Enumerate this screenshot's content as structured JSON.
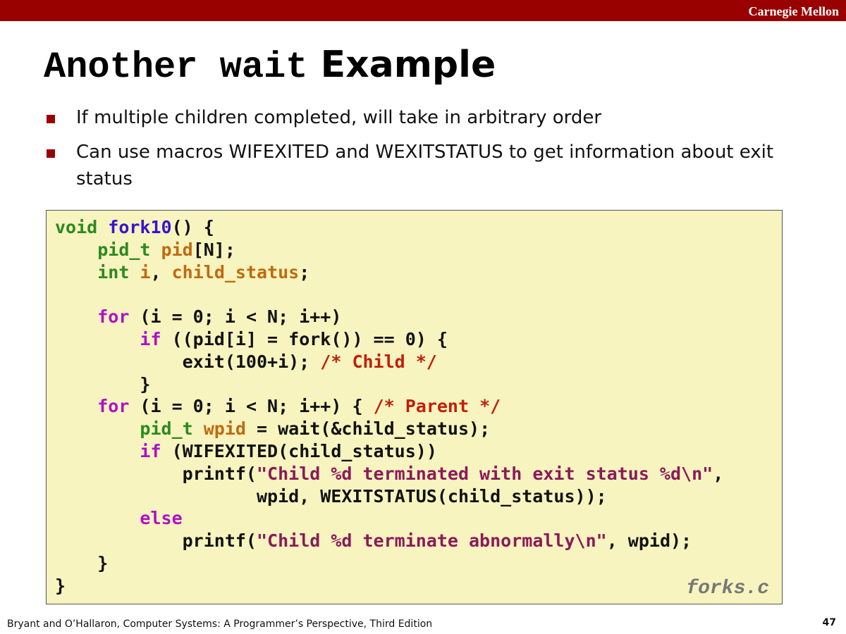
{
  "header": {
    "brand": "Carnegie Mellon",
    "bar_color": "#990000"
  },
  "slide": {
    "title_code": "Another wait",
    "title_text": "Example",
    "bullets": [
      "If multiple children completed, will take in arbitrary order",
      "Can use macros WIFEXITED and WEXITSTATUS to get information about exit status"
    ]
  },
  "code": {
    "filename": "forks.c",
    "lines": [
      [
        {
          "t": "void ",
          "c": "kw-green"
        },
        {
          "t": "fork10",
          "c": "fn-blue"
        },
        {
          "t": "() {"
        }
      ],
      [
        {
          "t": "    "
        },
        {
          "t": "pid_t ",
          "c": "kw-green"
        },
        {
          "t": "pid",
          "c": "var-orange"
        },
        {
          "t": "[N];"
        }
      ],
      [
        {
          "t": "    "
        },
        {
          "t": "int ",
          "c": "kw-green"
        },
        {
          "t": "i",
          "c": "var-orange"
        },
        {
          "t": ", "
        },
        {
          "t": "child_status",
          "c": "var-orange"
        },
        {
          "t": ";"
        }
      ],
      [
        {
          "t": ""
        }
      ],
      [
        {
          "t": "    "
        },
        {
          "t": "for",
          "c": "kw-purple"
        },
        {
          "t": " (i = 0; i < N; i++)"
        }
      ],
      [
        {
          "t": "        "
        },
        {
          "t": "if",
          "c": "kw-purple"
        },
        {
          "t": " ((pid[i] = fork()) == 0) {"
        }
      ],
      [
        {
          "t": "            exit(100+i); "
        },
        {
          "t": "/* Child */",
          "c": "comment"
        }
      ],
      [
        {
          "t": "        }"
        }
      ],
      [
        {
          "t": "    "
        },
        {
          "t": "for",
          "c": "kw-purple"
        },
        {
          "t": " (i = 0; i < N; i++) { "
        },
        {
          "t": "/* Parent */",
          "c": "comment"
        }
      ],
      [
        {
          "t": "        "
        },
        {
          "t": "pid_t ",
          "c": "kw-green"
        },
        {
          "t": "wpid",
          "c": "var-orange"
        },
        {
          "t": " = wait(&child_status);"
        }
      ],
      [
        {
          "t": "        "
        },
        {
          "t": "if",
          "c": "kw-purple"
        },
        {
          "t": " (WIFEXITED(child_status))"
        }
      ],
      [
        {
          "t": "            printf("
        },
        {
          "t": "\"Child %d terminated with exit status %d\\n\"",
          "c": "str"
        },
        {
          "t": ","
        }
      ],
      [
        {
          "t": "                   wpid, WEXITSTATUS(child_status));"
        }
      ],
      [
        {
          "t": "        "
        },
        {
          "t": "else",
          "c": "kw-purple"
        }
      ],
      [
        {
          "t": "            printf("
        },
        {
          "t": "\"Child %d terminate abnormally\\n\"",
          "c": "str"
        },
        {
          "t": ", wpid);"
        }
      ],
      [
        {
          "t": "    }"
        }
      ],
      [
        {
          "t": "}"
        }
      ]
    ]
  },
  "footer": {
    "citation": "Bryant and O’Hallaron, Computer Systems: A Programmer’s Perspective, Third Edition",
    "page_number": "47"
  }
}
